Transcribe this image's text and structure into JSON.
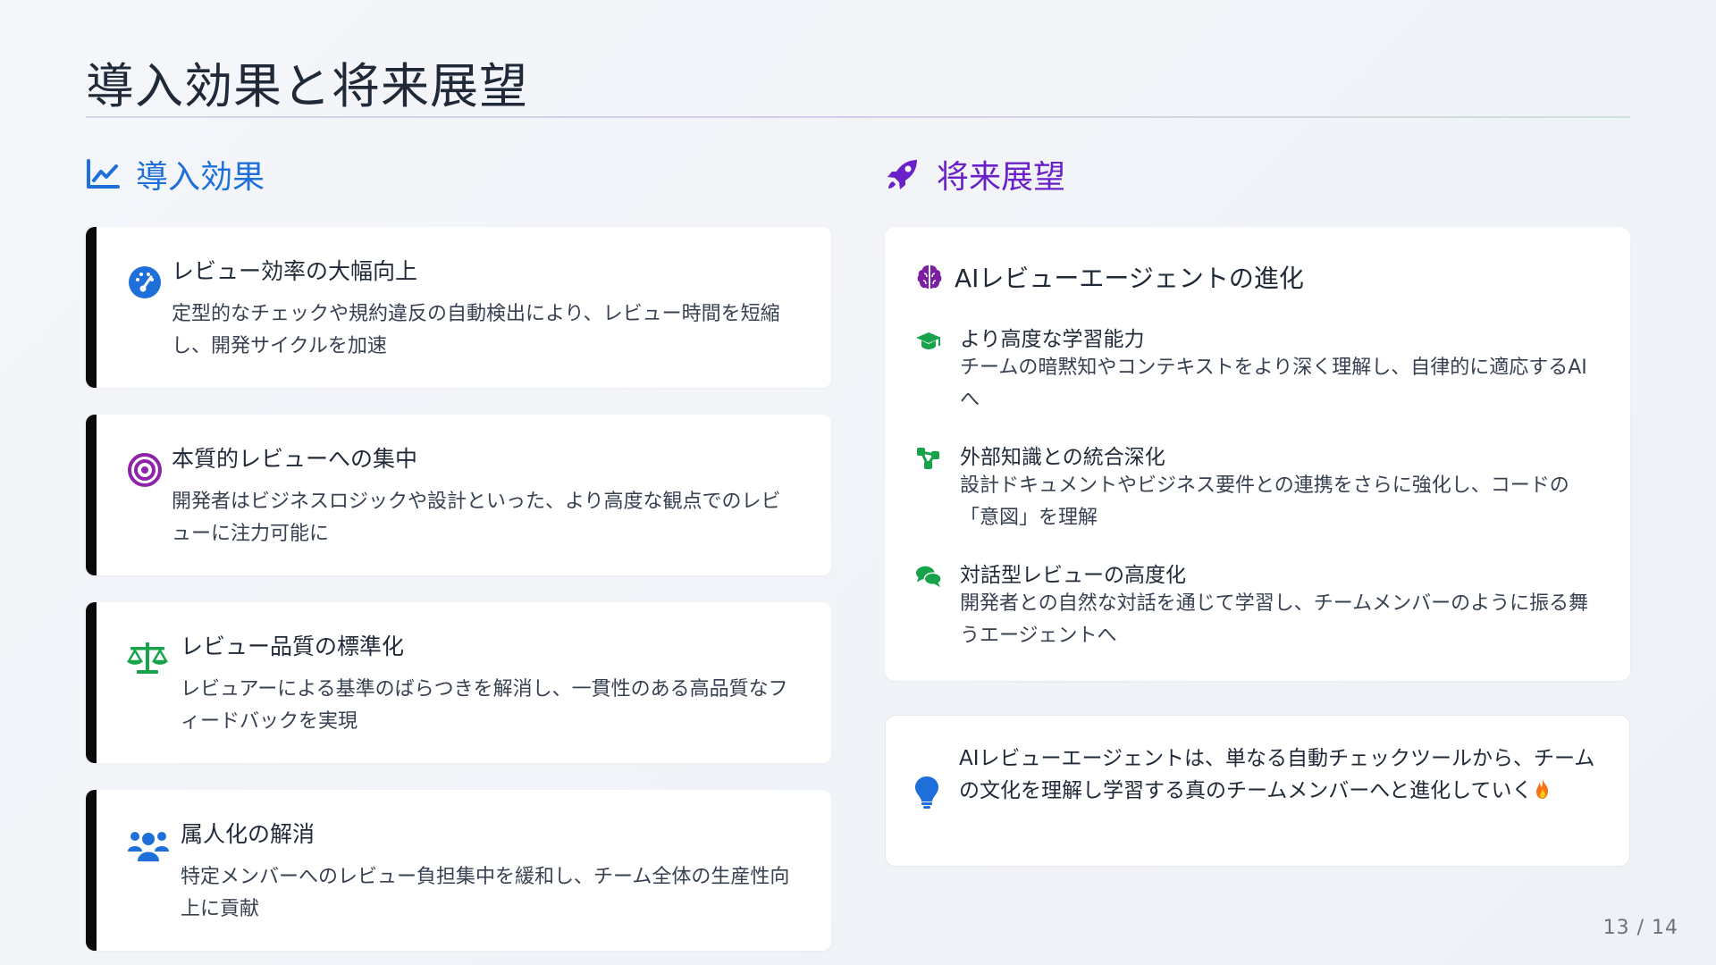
{
  "page": {
    "title": "導入効果と将来展望",
    "page_number": "13 / 14"
  },
  "colors": {
    "effect_accent": "#1e6fd9",
    "future_accent": "#6b21c8",
    "card_border": "#0a0a0a"
  },
  "effects": {
    "heading": "導入効果",
    "heading_icon": "chart-line-icon",
    "items": [
      {
        "icon": "gauge-icon",
        "title": "レビュー効率の大幅向上",
        "description": "定型的なチェックや規約違反の自動検出により、レビュー時間を短縮し、開発サイクルを加速"
      },
      {
        "icon": "target-icon",
        "title": "本質的レビューへの集中",
        "description": "開発者はビジネスロジックや設計といった、より高度な観点でのレビューに注力可能に"
      },
      {
        "icon": "scale-icon",
        "title": "レビュー品質の標準化",
        "description": "レビュアーによる基準のばらつきを解消し、一貫性のある高品質なフィードバックを実現"
      },
      {
        "icon": "users-icon",
        "title": "属人化の解消",
        "description": "特定メンバーへのレビュー負担集中を緩和し、チーム全体の生産性向上に貢献"
      }
    ]
  },
  "future": {
    "heading": "将来展望",
    "heading_icon": "rocket-icon",
    "card_title": "AIレビューエージェントの進化",
    "card_icon": "brain-icon",
    "items": [
      {
        "icon": "graduation-cap-icon",
        "title": "より高度な学習能力",
        "description": "チームの暗黙知やコンテキストをより深く理解し、自律的に適応するAIへ"
      },
      {
        "icon": "network-icon",
        "title": "外部知識との統合深化",
        "description": "設計ドキュメントやビジネス要件との連携をさらに強化し、コードの「意図」を理解"
      },
      {
        "icon": "chat-bubbles-icon",
        "title": "対話型レビューの高度化",
        "description": "開発者との自然な対話を通じて学習し、チームメンバーのように振る舞うエージェントへ"
      }
    ]
  },
  "quote": {
    "icon": "lightbulb-icon",
    "text": "AIレビューエージェントは、単なる自動チェックツールから、チームの文化を理解し学習する真のチームメンバーへと進化していく",
    "end_icon": "fire-icon"
  }
}
